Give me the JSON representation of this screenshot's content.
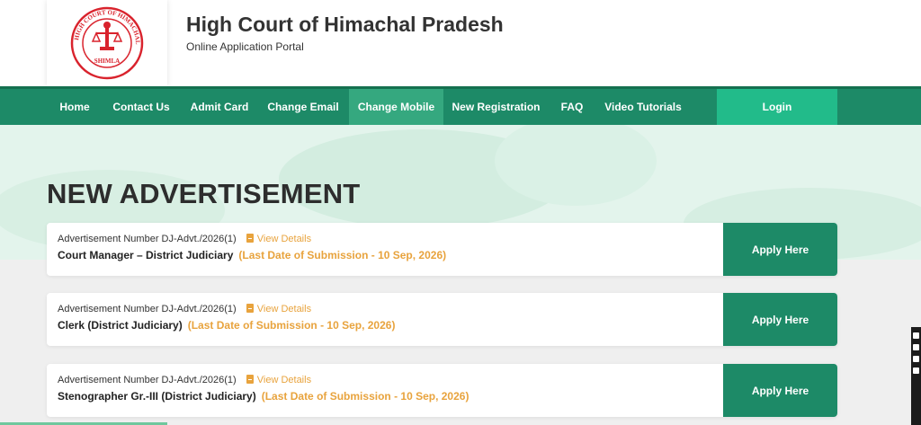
{
  "header": {
    "title": "High Court of Himachal Pradesh",
    "subtitle": "Online Application Portal",
    "logo_ring_text": "HIGH COURT OF HIMACHAL PRADESH",
    "logo_bottom_text": "SHIMLA"
  },
  "nav": {
    "items": [
      {
        "label": "Home"
      },
      {
        "label": "Contact Us"
      },
      {
        "label": "Admit Card"
      },
      {
        "label": "Change Email"
      },
      {
        "label": "Change Mobile"
      },
      {
        "label": "New Registration"
      },
      {
        "label": "FAQ"
      },
      {
        "label": "Video Tutorials"
      }
    ],
    "active": "Change Mobile",
    "login_label": "Login"
  },
  "page": {
    "title": "NEW ADVERTISEMENT"
  },
  "advertisements": [
    {
      "adv_number": "Advertisement Number DJ-Advt./2026(1)",
      "view_details": "View Details",
      "post": "Court Manager – District Judiciary",
      "deadline": "(Last Date of Submission - 10 Sep, 2026)",
      "apply_label": "Apply Here"
    },
    {
      "adv_number": "Advertisement Number DJ-Advt./2026(1)",
      "view_details": "View Details",
      "post": "Clerk (District Judiciary)",
      "deadline": "(Last Date of Submission - 10 Sep, 2026)",
      "apply_label": "Apply Here"
    },
    {
      "adv_number": "Advertisement Number DJ-Advt./2026(1)",
      "view_details": "View Details",
      "post": "Stenographer Gr.-III (District Judiciary)",
      "deadline": "(Last Date of Submission - 10 Sep, 2026)",
      "apply_label": "Apply Here"
    }
  ],
  "colors": {
    "brand_green": "#1d8a67",
    "active_nav": "#35a87f",
    "login_green": "#22bb8a",
    "accent_orange": "#e8a33d",
    "logo_red": "#d9232d"
  },
  "icons": {
    "logo": "high-court-emblem",
    "view_details": "file-icon"
  }
}
